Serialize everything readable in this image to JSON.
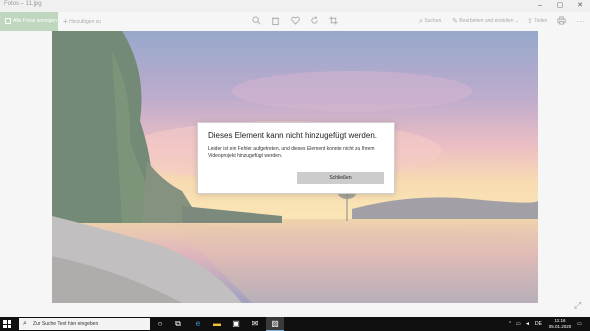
{
  "window": {
    "title": "Fotos – 11.jpg",
    "controls": {
      "minimize": "–",
      "maximize": "▢",
      "close": "✕"
    }
  },
  "toolbar": {
    "all_photos_label": "Alle Fotos anzeigen",
    "add_label": "Hinzufügen zu",
    "search_label": "Suchen",
    "edit_label": "Bearbeiten und erstellen",
    "share_label": "Teilen",
    "icons": [
      "zoom-icon",
      "delete-icon",
      "favorite-icon",
      "rotate-icon",
      "crop-icon",
      "print-icon",
      "more-icon"
    ]
  },
  "dialog": {
    "heading": "Dieses Element kann nicht hinzugefügt werden.",
    "message": "Leider ist ein Fehler aufgetreten, und dieses Element konnte nicht zu Ihrem Videoprojekt hinzugefügt werden.",
    "close_button": "Schließen"
  },
  "taskbar": {
    "search_placeholder": "Zur Suche Text hier eingeben",
    "time": "11:16",
    "date": "05.01.2020",
    "language": "DE"
  },
  "colors": {
    "accent_green": "#a6c8a6",
    "taskbar": "#101010",
    "dialog_button": "#cccccc"
  }
}
